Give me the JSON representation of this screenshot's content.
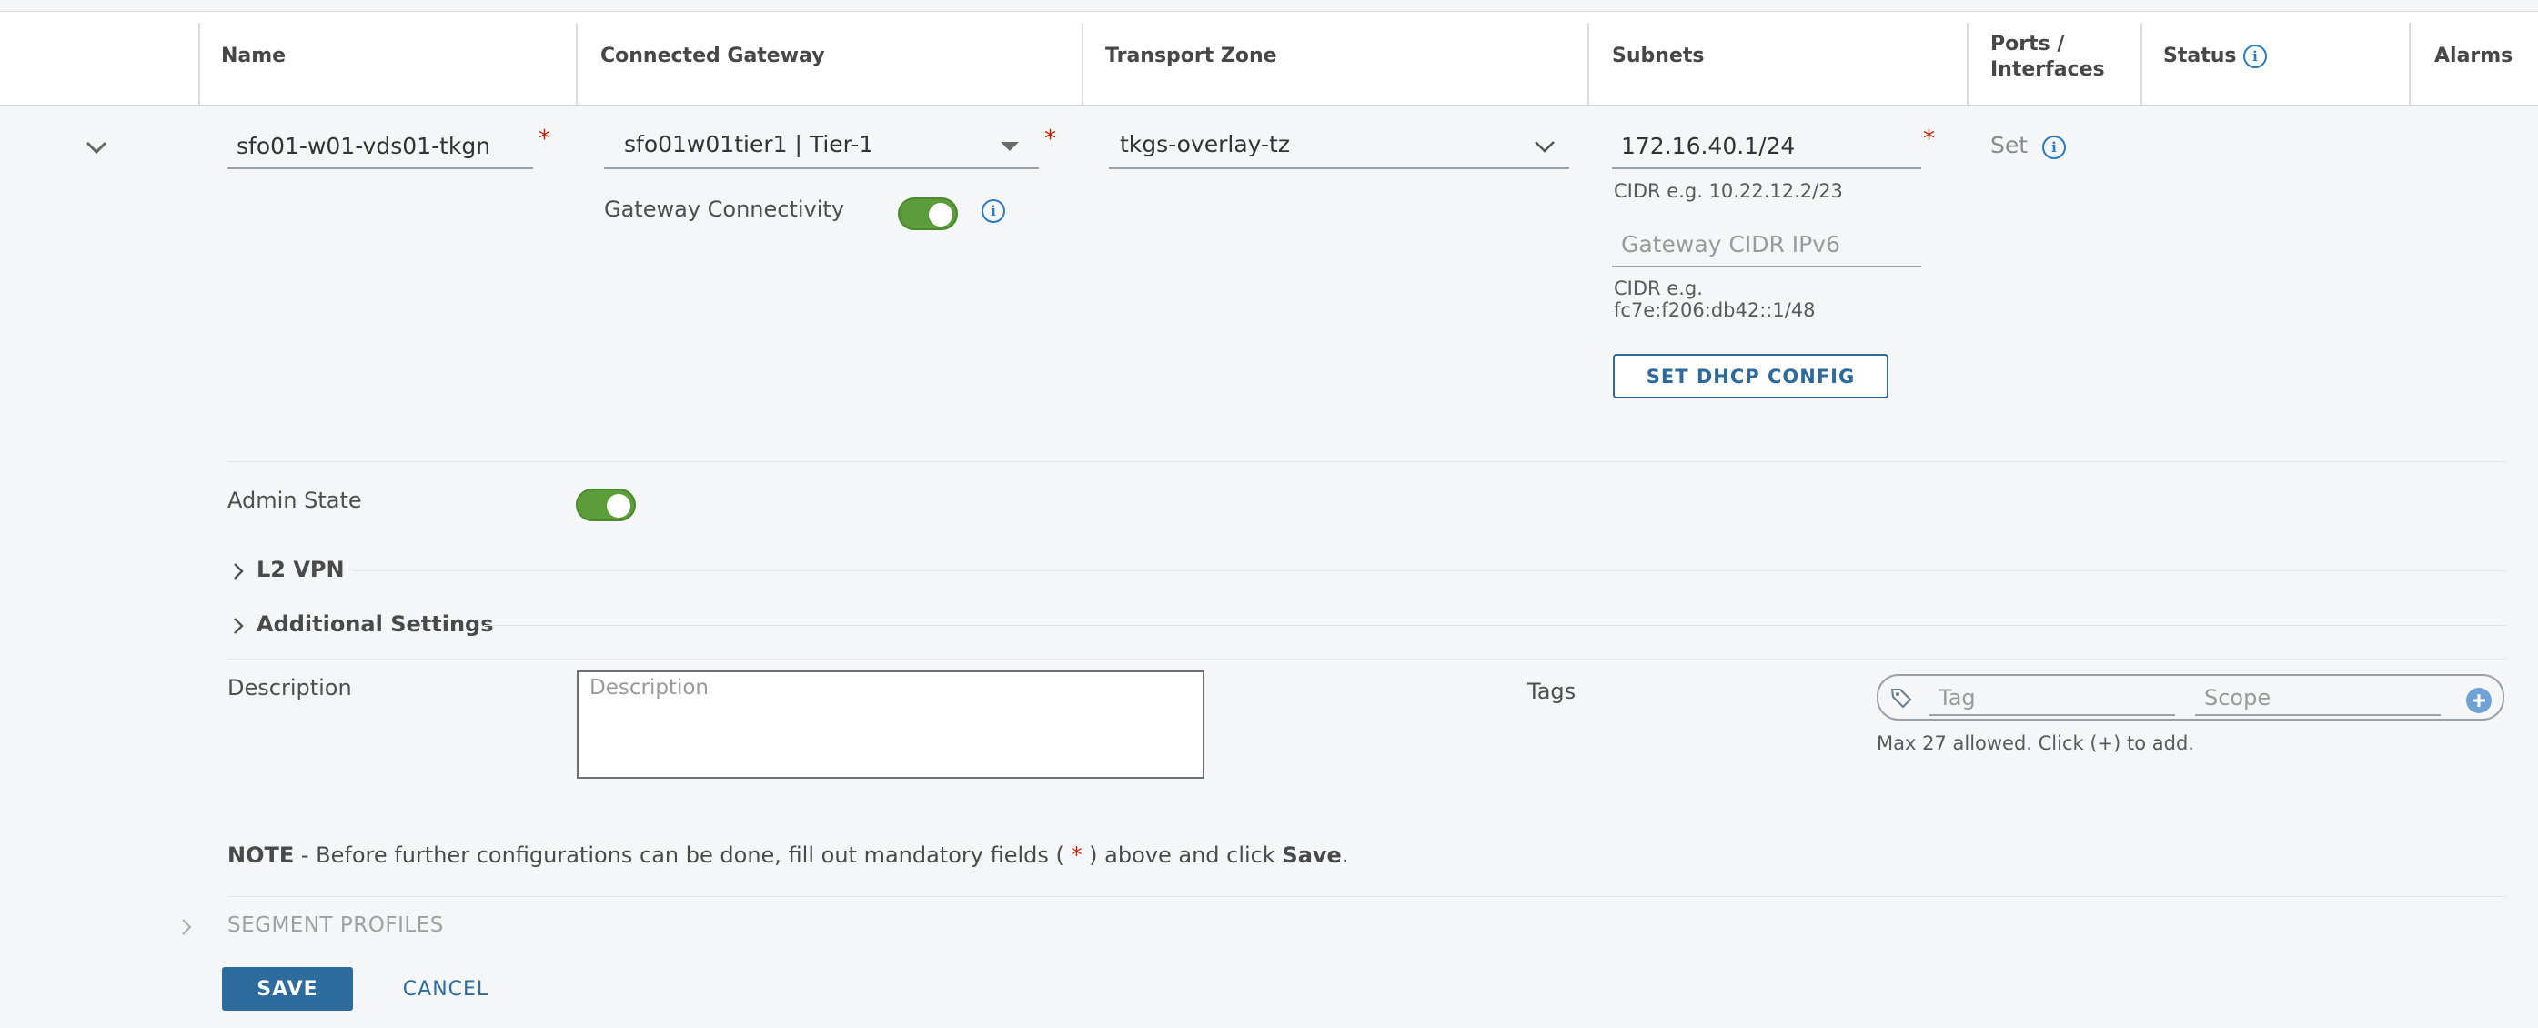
{
  "columns": {
    "name": "Name",
    "connected_gateway": "Connected Gateway",
    "transport_zone": "Transport Zone",
    "subnets": "Subnets",
    "ports_line1": "Ports /",
    "ports_line2": "Interfaces",
    "status": "Status",
    "alarms": "Alarms"
  },
  "row": {
    "name_value": "sfo01-w01-vds01-tkgn",
    "gateway_value": "sfo01w01tier1 | Tier-1",
    "gateway_connectivity_label": "Gateway Connectivity",
    "transport_zone_value": "tkgs-overlay-tz",
    "subnet_value": "172.16.40.1/24",
    "subnet_hint": "CIDR e.g. 10.22.12.2/23",
    "ipv6_placeholder": "Gateway CIDR IPv6",
    "ipv6_hint_line1": "CIDR e.g.",
    "ipv6_hint_line2": "fc7e:f206:db42::1/48",
    "dhcp_button": "SET DHCP CONFIG",
    "ports_set": "Set",
    "required_mark": "*"
  },
  "admin_state_label": "Admin State",
  "sections": {
    "l2vpn": "L2 VPN",
    "additional_settings": "Additional Settings",
    "segment_profiles": "SEGMENT PROFILES"
  },
  "description": {
    "label": "Description",
    "placeholder": "Description"
  },
  "tags": {
    "label": "Tags",
    "tag_placeholder": "Tag",
    "scope_placeholder": "Scope",
    "hint": "Max 27 allowed. Click (+) to add."
  },
  "note": {
    "prefix": "NOTE",
    "text_a": " - Before further configurations can be done, fill out mandatory fields ( ",
    "star": "*",
    "text_b": " ) above and click ",
    "save_word": "Save",
    "end": "."
  },
  "buttons": {
    "save": "SAVE",
    "cancel": "CANCEL"
  },
  "icons": {
    "info": "i"
  },
  "colors": {
    "accent": "#2e6c9e",
    "toggle_on": "#5c9c3a",
    "required": "#c92100"
  }
}
